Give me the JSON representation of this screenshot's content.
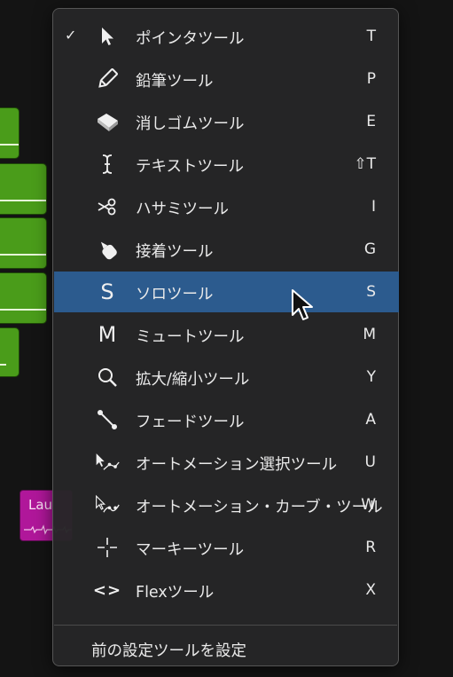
{
  "menu": {
    "items": [
      {
        "label": "ポインタツール",
        "shortcut": "T",
        "icon": "pointer-icon",
        "checked": true
      },
      {
        "label": "鉛筆ツール",
        "shortcut": "P",
        "icon": "pencil-icon"
      },
      {
        "label": "消しゴムツール",
        "shortcut": "E",
        "icon": "eraser-icon"
      },
      {
        "label": "テキストツール",
        "shortcut": "⇧T",
        "icon": "text-cursor-icon"
      },
      {
        "label": "ハサミツール",
        "shortcut": "I",
        "icon": "scissors-icon"
      },
      {
        "label": "接着ツール",
        "shortcut": "G",
        "icon": "glue-icon"
      },
      {
        "label": "ソロツール",
        "shortcut": "S",
        "icon": "solo-icon",
        "glyph": "S",
        "selected": true
      },
      {
        "label": "ミュートツール",
        "shortcut": "M",
        "icon": "mute-icon",
        "glyph": "M"
      },
      {
        "label": "拡大/縮小ツール",
        "shortcut": "Y",
        "icon": "zoom-icon"
      },
      {
        "label": "フェードツール",
        "shortcut": "A",
        "icon": "fade-icon"
      },
      {
        "label": "オートメーション選択ツール",
        "shortcut": "U",
        "icon": "automation-select-icon"
      },
      {
        "label": "オートメーション・カーブ・ツール",
        "shortcut": "W",
        "icon": "automation-curve-icon"
      },
      {
        "label": "マーキーツール",
        "shortcut": "R",
        "icon": "marquee-icon"
      },
      {
        "label": "Flexツール",
        "shortcut": "X",
        "icon": "flex-icon",
        "glyph": "<>"
      }
    ],
    "footer": "前の設定ツールを設定",
    "check_mark": "✓"
  },
  "background": {
    "region_label": "Lau",
    "accent_green": "#4a9c1a",
    "accent_magenta": "#b0179a",
    "highlight": "#2c5b8e"
  }
}
